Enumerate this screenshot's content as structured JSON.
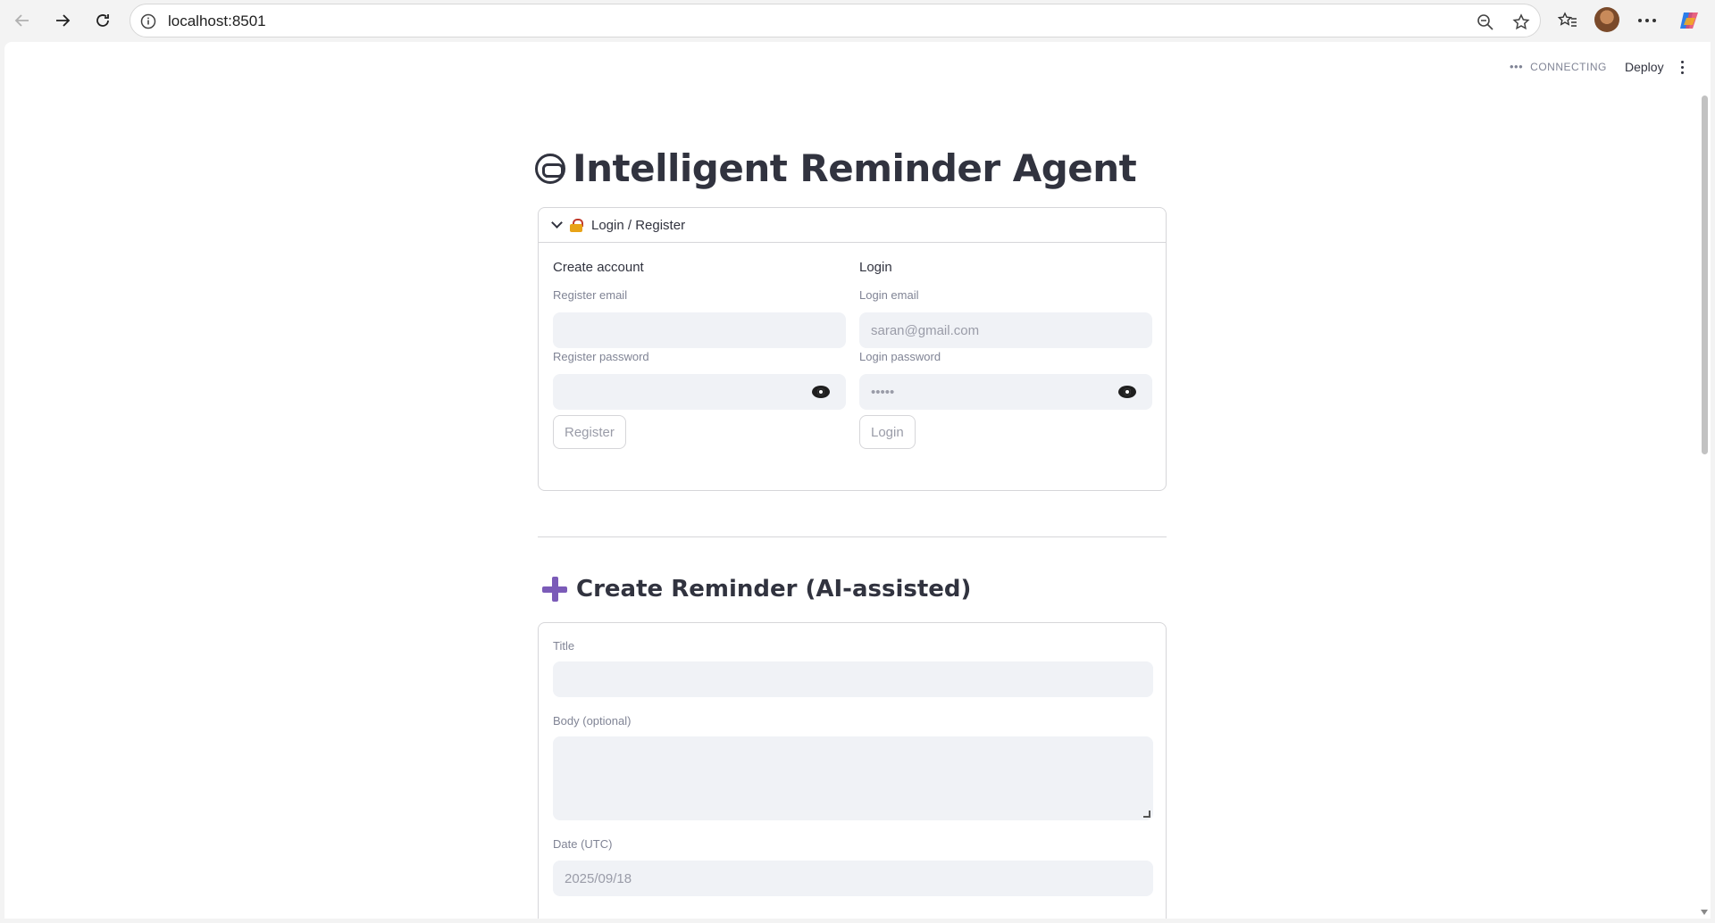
{
  "browser": {
    "url": "localhost:8501",
    "icons": [
      "back-icon",
      "forward-icon",
      "refresh-icon",
      "info-icon",
      "zoom-out-icon",
      "star-icon",
      "favorites-icon",
      "avatar",
      "more-icon",
      "copilot-icon"
    ]
  },
  "app_bar": {
    "status": "CONNECTING",
    "deploy_label": "Deploy"
  },
  "page": {
    "title": "Intelligent Reminder Agent"
  },
  "auth": {
    "expander_label": "Login / Register",
    "register": {
      "heading": "Create account",
      "email_label": "Register email",
      "email_value": "",
      "password_label": "Register password",
      "password_value": "",
      "button": "Register"
    },
    "login": {
      "heading": "Login",
      "email_label": "Login email",
      "email_value": "saran@gmail.com",
      "password_label": "Login password",
      "password_value": "•••••",
      "button": "Login"
    }
  },
  "reminder": {
    "heading": "Create Reminder (AI-assisted)",
    "title_label": "Title",
    "title_value": "",
    "body_label": "Body (optional)",
    "body_value": "",
    "date_label": "Date (UTC)",
    "date_value": "2025/09/18"
  },
  "colors": {
    "accent_purple": "#7b5bb8",
    "input_bg": "#f0f2f6",
    "text": "#31333f",
    "muted": "#808495"
  }
}
